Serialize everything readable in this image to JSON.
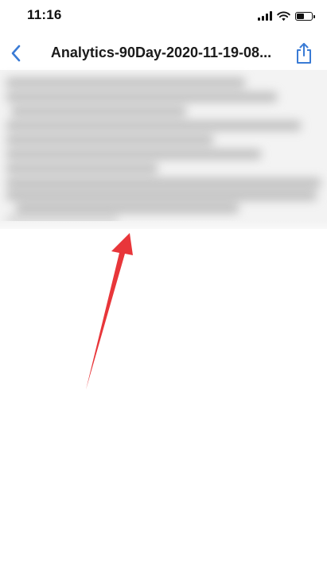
{
  "status_bar": {
    "time": "11:16",
    "signal_icon": "cellular-signal-icon",
    "wifi_icon": "wifi-icon",
    "battery_icon": "battery-icon",
    "battery_level": 0.5
  },
  "nav_bar": {
    "title": "Analytics-90Day-2020-11-19-08...",
    "back_icon": "chevron-left-icon",
    "share_icon": "share-icon"
  },
  "document": {
    "content_state": "blurred"
  },
  "annotation": {
    "arrow_icon": "red-arrow-annotation",
    "color": "#e8363a"
  },
  "colors": {
    "accent": "#3a7bd5",
    "title": "#1a1a1a",
    "background": "#ffffff"
  }
}
